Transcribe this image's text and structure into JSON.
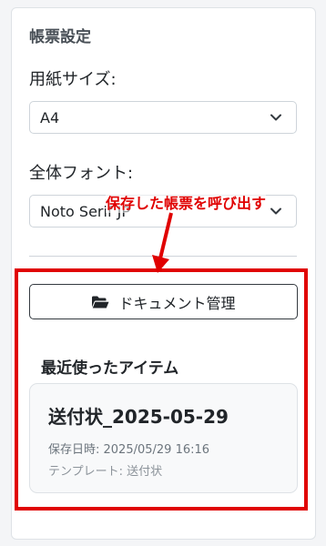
{
  "settings": {
    "title": "帳票設定",
    "paper_size": {
      "label": "用紙サイズ:",
      "value": "A4"
    },
    "font": {
      "label": "全体フォント:",
      "value": "Noto Serif JP"
    }
  },
  "annotation": {
    "text": "保存した帳票を呼び出す",
    "color": "#e00000"
  },
  "documents": {
    "manage_button": "ドキュメント管理",
    "recent_title": "最近使ったアイテム",
    "recent_items": [
      {
        "name": "送付状_2025-05-29",
        "saved_at": "保存日時: 2025/05/29 16:16",
        "template": "テンプレート: 送付状"
      }
    ]
  },
  "icons": {
    "chevron": "chevron-down-icon",
    "folder": "folder-open-icon"
  }
}
